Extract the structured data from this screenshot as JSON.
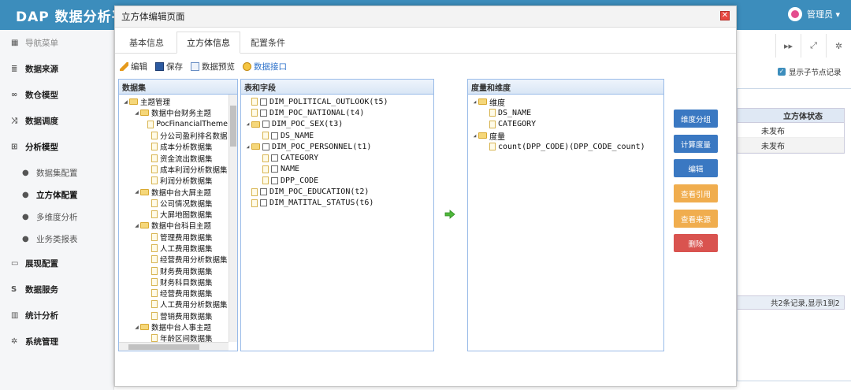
{
  "app": {
    "brand": "DAP 数据分析平",
    "user": "管理员 ▾"
  },
  "sidebar": {
    "header": "导航菜单",
    "items": [
      {
        "label": "数据来源",
        "icon": "database-icon"
      },
      {
        "label": "数仓模型",
        "icon": "link-icon"
      },
      {
        "label": "数据调度",
        "icon": "shuffle-icon"
      },
      {
        "label": "分析模型",
        "icon": "sitemap-icon"
      },
      {
        "label": "数据集配置",
        "icon": "dot-icon"
      },
      {
        "label": "立方体配置",
        "icon": "dot-icon"
      },
      {
        "label": "多维度分析",
        "icon": "dot-icon"
      },
      {
        "label": "业务类报表",
        "icon": "dot-icon"
      },
      {
        "label": "展现配置",
        "icon": "window-icon"
      },
      {
        "label": "数据服务",
        "icon": "s-icon"
      },
      {
        "label": "统计分析",
        "icon": "bar-chart-icon"
      },
      {
        "label": "系统管理",
        "icon": "gear-icon"
      }
    ]
  },
  "background": {
    "show_child_records": "显示子节点记录",
    "table_header": "立方体状态",
    "rows": [
      "未发布",
      "未发布"
    ],
    "pager": "共2条记录,显示1到2"
  },
  "modal": {
    "title": "立方体编辑页面",
    "close_symbol": "✕",
    "tabs": [
      "基本信息",
      "立方体信息",
      "配置条件"
    ],
    "toolbar": [
      "编辑",
      "保存",
      "数据预览",
      "数据接口"
    ],
    "dataset_panel": {
      "title": "数据集",
      "tree": [
        {
          "label": "主题管理",
          "level": 0,
          "type": "folder",
          "open": true
        },
        {
          "label": "数据中台财务主题",
          "level": 1,
          "type": "folder",
          "open": true
        },
        {
          "label": "PocFinancialTheme",
          "level": 2,
          "type": "doc"
        },
        {
          "label": "分公司盈利排名数据",
          "level": 2,
          "type": "doc"
        },
        {
          "label": "成本分析数据集",
          "level": 2,
          "type": "doc"
        },
        {
          "label": "资金流出数据集",
          "level": 2,
          "type": "doc"
        },
        {
          "label": "成本利润分析数据集",
          "level": 2,
          "type": "doc"
        },
        {
          "label": "利润分析数据集",
          "level": 2,
          "type": "doc"
        },
        {
          "label": "数据中台大屏主题",
          "level": 1,
          "type": "folder",
          "open": true
        },
        {
          "label": "公司情况数据集",
          "level": 2,
          "type": "doc"
        },
        {
          "label": "大屏地图数据集",
          "level": 2,
          "type": "doc"
        },
        {
          "label": "数据中台科目主题",
          "level": 1,
          "type": "folder",
          "open": true
        },
        {
          "label": "管理费用数据集",
          "level": 2,
          "type": "doc"
        },
        {
          "label": "人工费用数据集",
          "level": 2,
          "type": "doc"
        },
        {
          "label": "经营费用分析数据集",
          "level": 2,
          "type": "doc"
        },
        {
          "label": "财务费用数据集",
          "level": 2,
          "type": "doc"
        },
        {
          "label": "财务科目数据集",
          "level": 2,
          "type": "doc"
        },
        {
          "label": "经营费用数据集",
          "level": 2,
          "type": "doc"
        },
        {
          "label": "人工费用分析数据集",
          "level": 2,
          "type": "doc"
        },
        {
          "label": "营销费用数据集",
          "level": 2,
          "type": "doc"
        },
        {
          "label": "数据中台人事主题",
          "level": 1,
          "type": "folder",
          "open": true
        },
        {
          "label": "年龄区间数据集",
          "level": 2,
          "type": "doc"
        }
      ]
    },
    "fields_panel": {
      "title": "表和字段",
      "tree": [
        {
          "label": "DIM_POLITICAL_OUTLOOK(t5)",
          "level": 0,
          "type": "doc-check"
        },
        {
          "label": "DIM_POC_NATIONAL(t4)",
          "level": 0,
          "type": "doc-check"
        },
        {
          "label": "DIM_POC_SEX(t3)",
          "level": 0,
          "type": "folder-check",
          "open": true
        },
        {
          "label": "DS_NAME",
          "level": 1,
          "type": "doc-check"
        },
        {
          "label": "DIM_POC_PERSONNEL(t1)",
          "level": 0,
          "type": "folder-check",
          "open": true
        },
        {
          "label": "CATEGORY",
          "level": 1,
          "type": "doc-check"
        },
        {
          "label": "NAME",
          "level": 1,
          "type": "doc-check"
        },
        {
          "label": "DPP_CODE",
          "level": 1,
          "type": "doc-check"
        },
        {
          "label": "DIM_POC_EDUCATION(t2)",
          "level": 0,
          "type": "doc-check"
        },
        {
          "label": "DIM_MATITAL_STATUS(t6)",
          "level": 0,
          "type": "doc-check"
        }
      ]
    },
    "measures_panel": {
      "title": "度量和维度",
      "tree": [
        {
          "label": "维度",
          "level": 0,
          "type": "folder",
          "open": true
        },
        {
          "label": "DS_NAME",
          "level": 1,
          "type": "doc"
        },
        {
          "label": "CATEGORY",
          "level": 1,
          "type": "doc"
        },
        {
          "label": "度量",
          "level": 0,
          "type": "folder",
          "open": true
        },
        {
          "label": "count(DPP_CODE)(DPP_CODE_count)",
          "level": 1,
          "type": "doc"
        }
      ]
    },
    "buttons": [
      {
        "label": "维度分组",
        "color": "#3a78c2"
      },
      {
        "label": "计算度量",
        "color": "#3a78c2"
      },
      {
        "label": "编辑",
        "color": "#3a78c2"
      },
      {
        "label": "查看引用",
        "color": "#f0ad4e"
      },
      {
        "label": "查看来源",
        "color": "#f0ad4e"
      },
      {
        "label": "删除",
        "color": "#d9534f"
      }
    ]
  }
}
